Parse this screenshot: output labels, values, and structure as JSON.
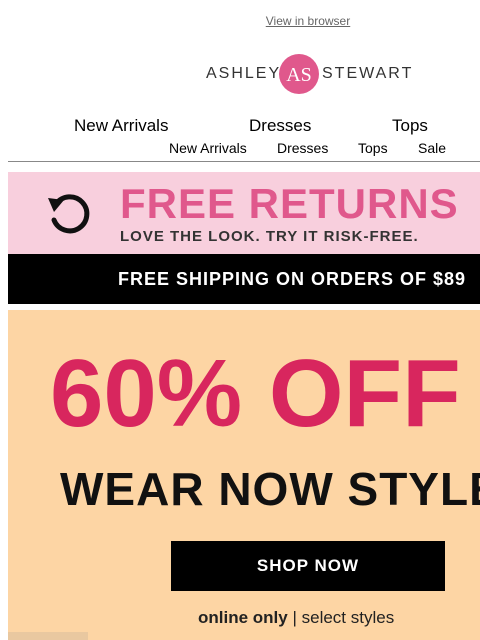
{
  "header": {
    "view_in_browser": "View in browser",
    "logo_left": "ASHLEY",
    "logo_right": "STEWART",
    "logo_monogram": "AS"
  },
  "nav_primary": [
    "New Arrivals",
    "Dresses",
    "Tops"
  ],
  "nav_secondary": [
    "New Arrivals",
    "Dresses",
    "Tops",
    "Sale"
  ],
  "returns_banner": {
    "title": "FREE RETURNS",
    "subtitle": "LOVE THE LOOK. TRY IT RISK-FREE."
  },
  "shipping_banner": {
    "text": "FREE SHIPPING ON ORDERS OF $89"
  },
  "promo": {
    "headline": "60% OFF",
    "subheadline": "WEAR NOW STYLES",
    "button": "SHOP NOW",
    "note_bold": "online only",
    "note_sep": " | ",
    "note_rest": "select styles"
  },
  "colors": {
    "brand_pink": "#d8265e",
    "returns_bg": "#f8cfdd",
    "promo_bg": "#fdd5a4"
  }
}
